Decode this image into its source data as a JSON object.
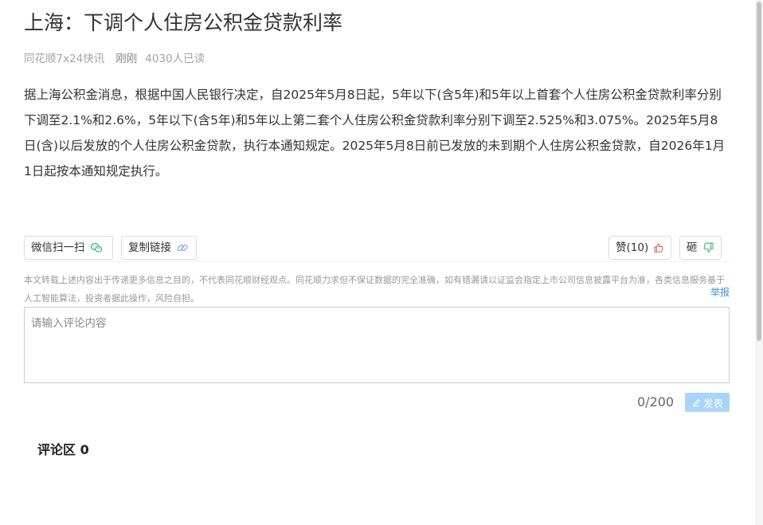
{
  "article": {
    "title": "上海：下调个人住房公积金贷款利率",
    "source": "同花顺7x24快讯",
    "time": "刚刚",
    "reads": "4030人已读",
    "body": "据上海公积金消息，根据中国人民银行决定，自2025年5月8日起，5年以下(含5年)和5年以上首套个人住房公积金贷款利率分别下调至2.1%和2.6%，5年以下(含5年)和5年以上第二套个人住房公积金贷款利率分别下调至2.525%和3.075%。2025年5月8日(含)以后发放的个人住房公积金贷款，执行本通知规定。2025年5月8日前已发放的未到期个人住房公积金贷款，自2026年1月1日起按本通知规定执行。"
  },
  "actions": {
    "wechat_label": "微信扫一扫",
    "copy_label": "复制链接",
    "like_label": "赞(10)",
    "dislike_label": "砸"
  },
  "disclaimer": {
    "text": "本文转载上述内容出于传递更多信息之目的，不代表同花顺财经观点。同花顺力求但不保证数据的完全准确，如有错漏请以证监会指定上市公司信息披露平台为准，各类信息服务基于人工智能算法，投资者据此操作，风险自担。",
    "report_label": "举报"
  },
  "comment": {
    "placeholder": "请输入评论内容",
    "value": "",
    "counter": "0/200",
    "submit_label": "发表"
  },
  "comments_section": {
    "header": "评论区 0"
  },
  "colors": {
    "link": "#3b8ee6",
    "wechat_icon": "#3cb371",
    "like_icon": "#e64545",
    "dislike_icon": "#3cb371",
    "submit_bg": "#a7d4f8"
  }
}
